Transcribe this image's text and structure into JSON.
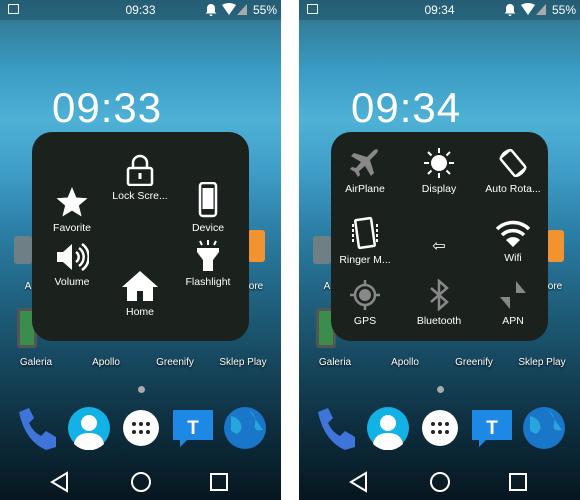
{
  "screens": [
    {
      "status": {
        "time": "09:33",
        "battery": "55%"
      },
      "clock": "09:33",
      "menu": {
        "lock": "Lock Scre...",
        "favorite": "Favorite",
        "device": "Device",
        "volume": "Volume",
        "flashlight": "Flashlight",
        "home": "Home"
      }
    },
    {
      "status": {
        "time": "09:34",
        "battery": "55%"
      },
      "clock": "09:34",
      "menu": {
        "airplane": "AirPlane",
        "display": "Display",
        "rotate": "Auto Rota...",
        "ringer": "Ringer M...",
        "wifi": "Wifi",
        "gps": "GPS",
        "bluetooth": "Bluetooth",
        "apn": "APN",
        "back": "⇦"
      }
    }
  ],
  "apps": {
    "row1_left": "A",
    "row1_right": "ore",
    "galeria": "Galeria",
    "apollo": "Apollo",
    "greenify": "Greenify",
    "sklep": "Sklep Play"
  },
  "dock": [
    "phone",
    "contacts",
    "app-drawer",
    "messages",
    "browser"
  ],
  "colors": {
    "panel": "#1b211d",
    "orange": "#f2932f",
    "blue": "#1e88e5"
  }
}
